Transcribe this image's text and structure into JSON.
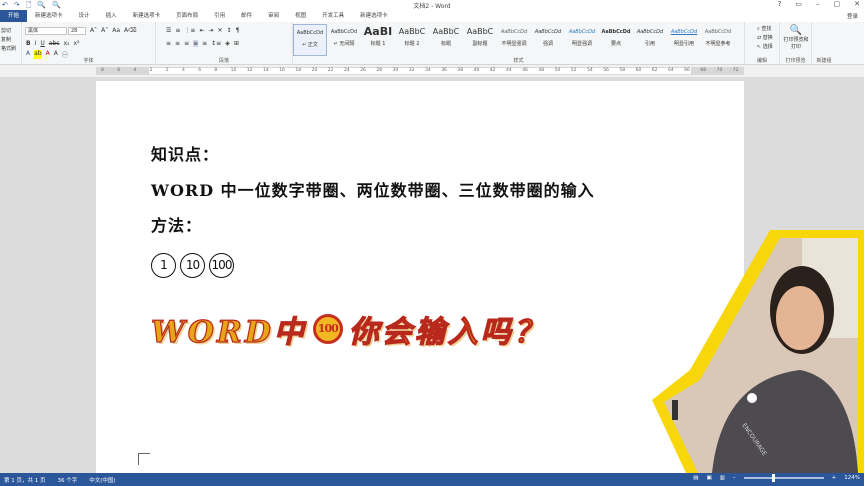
{
  "window": {
    "title": "文档2 - Word",
    "login": "登录"
  },
  "quick_access": [
    "↶",
    "↷",
    "🗋",
    "🔍",
    "🔍"
  ],
  "window_controls": [
    "?",
    "▭",
    "–",
    "▢",
    "✕"
  ],
  "tabs": [
    "开始",
    "新建选项卡",
    "设计",
    "插入",
    "新建选项卡",
    "页面布局",
    "引用",
    "邮件",
    "审阅",
    "视图",
    "开发工具",
    "新建选项卡"
  ],
  "ribbon": {
    "clipboard": {
      "items": [
        "剪切",
        "复制",
        "格式刷"
      ],
      "label": ""
    },
    "font": {
      "name": "黑体",
      "size": "28",
      "label": "字体"
    },
    "paragraph": {
      "label": "段落"
    },
    "styles": {
      "label": "样式",
      "items": [
        {
          "preview": "AaBbCcDd",
          "name": "↵ 正文"
        },
        {
          "preview": "AaBbCcDd",
          "name": "↵ 无间隔"
        },
        {
          "preview": "AaBI",
          "name": "标题 1"
        },
        {
          "preview": "AaBbC",
          "name": "标题 2"
        },
        {
          "preview": "AaBbC",
          "name": "标题"
        },
        {
          "preview": "AaBbC",
          "name": "副标题"
        },
        {
          "preview": "AaBbCcDd",
          "name": "不明显强调"
        },
        {
          "preview": "AaBbCcDd",
          "name": "强调"
        },
        {
          "preview": "AaBbCcDd",
          "name": "明显强调"
        },
        {
          "preview": "AaBbCcDd",
          "name": "要点"
        },
        {
          "preview": "AaBbCcDd",
          "name": "引用"
        },
        {
          "preview": "AaBbCcDd",
          "name": "明显引用"
        },
        {
          "preview": "AaBbCcDd",
          "name": "不明显参考"
        }
      ]
    },
    "editing": {
      "label": "编辑",
      "items": [
        "查找",
        "替换",
        "选择"
      ]
    },
    "print": {
      "button": "打印预览和打印",
      "label": "打印预览"
    },
    "new_group": {
      "label": "新建组"
    }
  },
  "ruler": [
    "8",
    "6",
    "4",
    "2",
    "2",
    "4",
    "6",
    "8",
    "10",
    "12",
    "14",
    "16",
    "18",
    "20",
    "22",
    "24",
    "26",
    "28",
    "30",
    "32",
    "34",
    "36",
    "38",
    "40",
    "42",
    "44",
    "46",
    "48",
    "50",
    "52",
    "54",
    "56",
    "58",
    "60",
    "62",
    "64",
    "66",
    "68",
    "70",
    "72"
  ],
  "document": {
    "line1": "知识点：",
    "line2": "WORD 中一位数字带圈、两位数带圈、三位数带圈的输入",
    "line3": "方法：",
    "circled": [
      "1",
      "10",
      "100"
    ],
    "banner_pre": "WORD中",
    "banner_circle": "100",
    "banner_post": "你会输入吗？"
  },
  "status": {
    "page": "第 1 页，共 1 页",
    "words": "36 个字",
    "lang": "中文(中国)",
    "zoom": "124%"
  },
  "colors": {
    "accent": "#2b579a",
    "banner_fill": "#e8a616",
    "banner_stroke": "#b8281c"
  }
}
